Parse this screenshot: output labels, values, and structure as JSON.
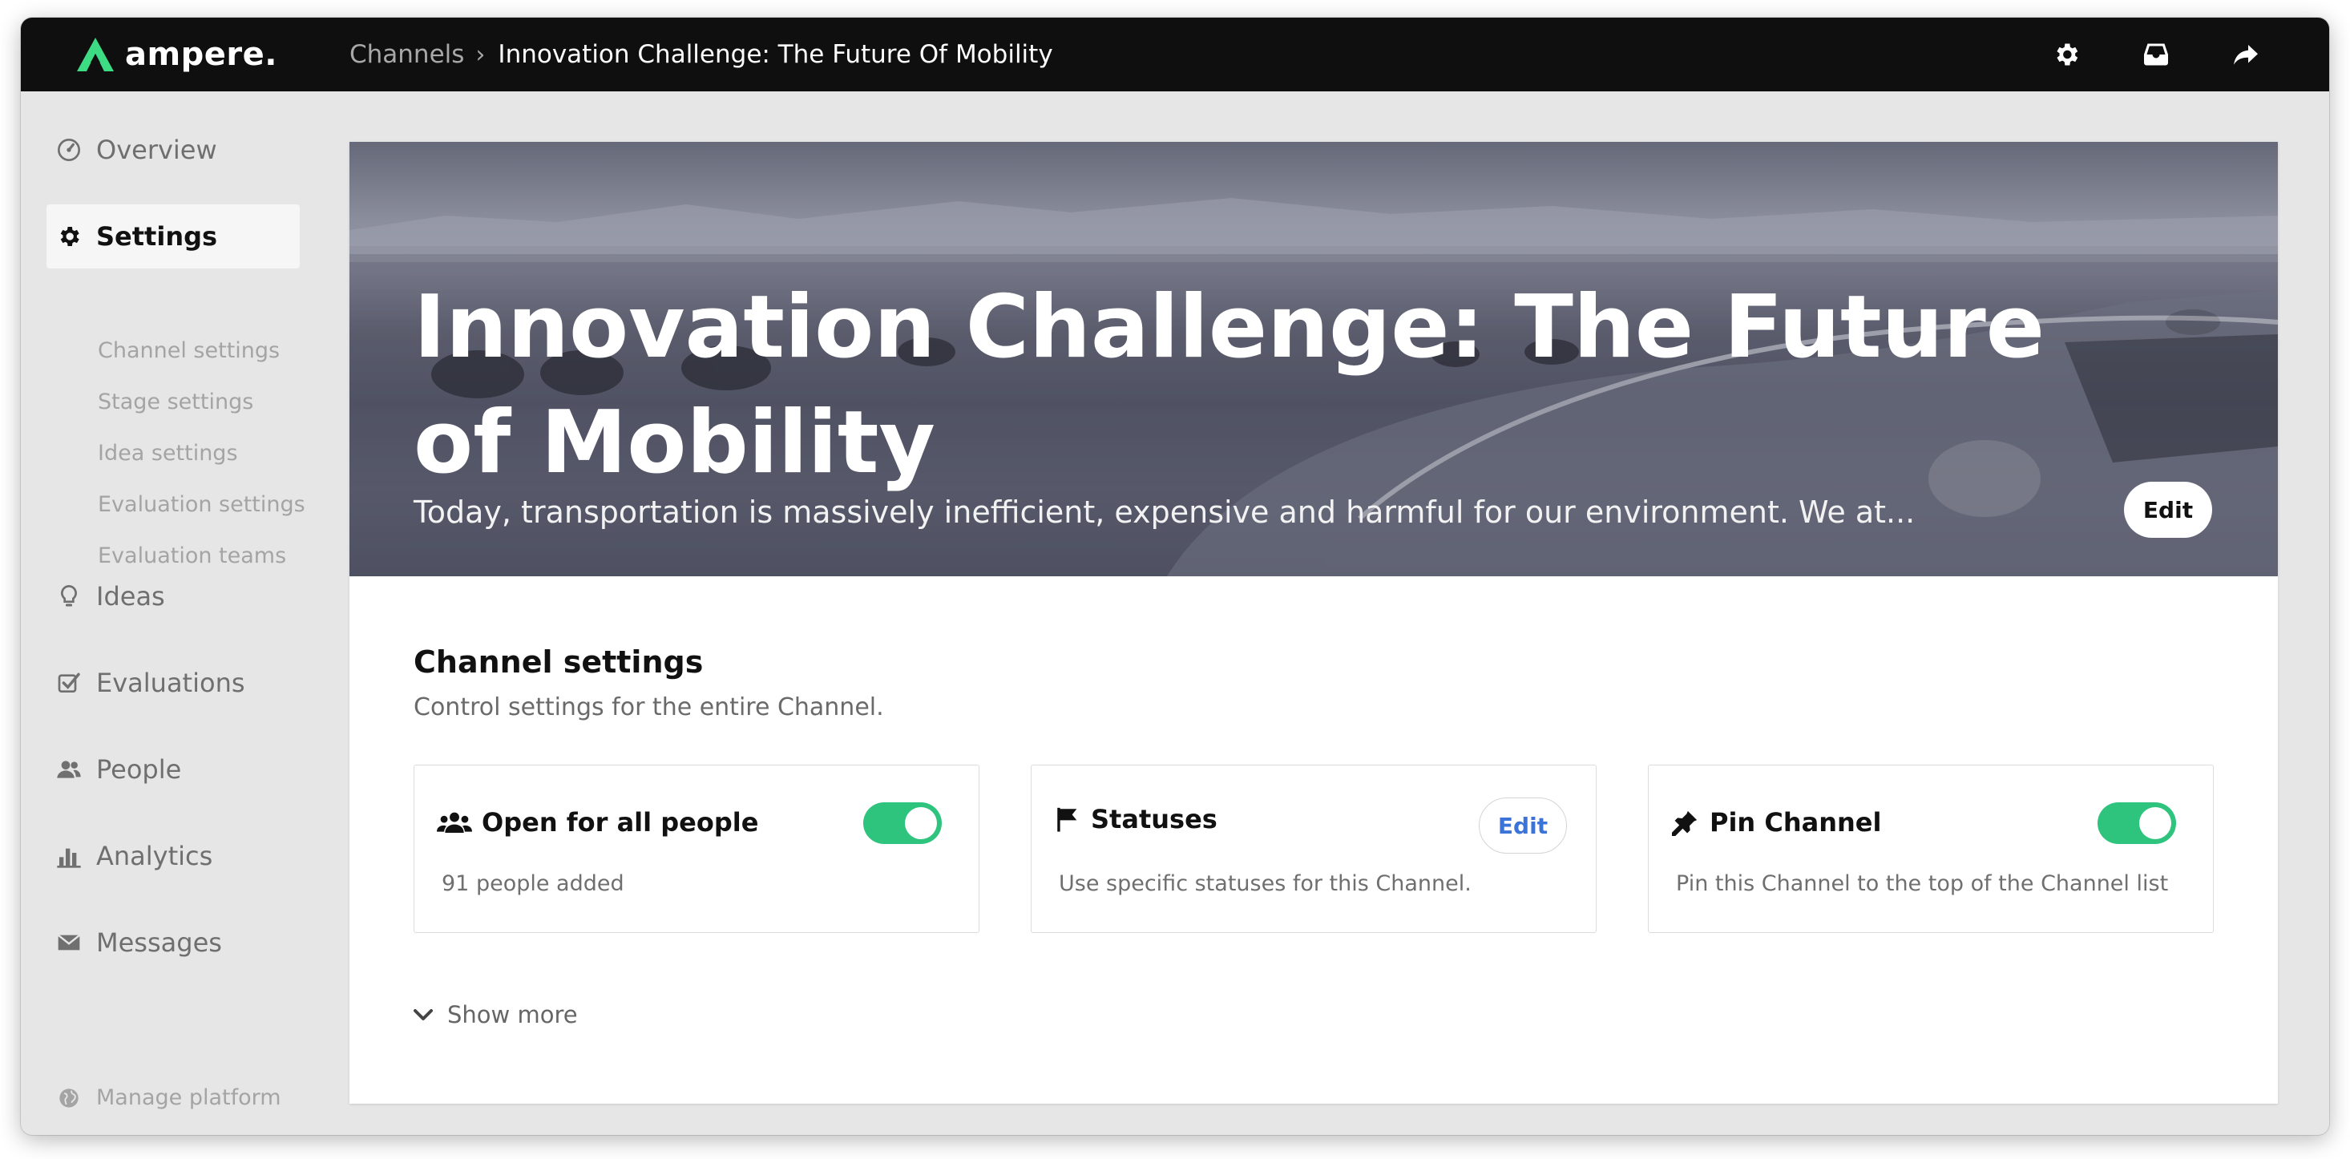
{
  "header": {
    "logo_text": "ampere.",
    "breadcrumb": {
      "parent": "Channels",
      "separator": "›",
      "current": "Innovation Challenge: The Future Of Mobility"
    },
    "icons": [
      "gear-icon",
      "inbox-icon",
      "share-icon"
    ]
  },
  "sidebar": {
    "overview": "Overview",
    "settings": "Settings",
    "settings_sub": [
      "Channel settings",
      "Stage settings",
      "Idea settings",
      "Evaluation settings",
      "Evaluation teams"
    ],
    "ideas": "Ideas",
    "evaluations": "Evaluations",
    "people": "People",
    "analytics": "Analytics",
    "messages": "Messages",
    "manage_platform": "Manage platform"
  },
  "hero": {
    "title": "Innovation Challenge: The Future of Mobility",
    "description": "Today, transportation is massively inefficient, expensive and harmful for our environment. We at...",
    "edit_label": "Edit"
  },
  "channel_settings": {
    "title": "Channel settings",
    "subtitle": "Control settings for the entire Channel.",
    "cards": [
      {
        "title": "Open for all people",
        "description": "91 people added",
        "toggle_on": true
      },
      {
        "title": "Statuses",
        "description": "Use specific statuses for this Channel.",
        "edit_label": "Edit"
      },
      {
        "title": "Pin Channel",
        "description": "Pin this Channel to the top of the Channel list",
        "toggle_on": true
      }
    ],
    "show_more": "Show more"
  },
  "colors": {
    "accent_green": "#2ec47d",
    "link_blue": "#3b73d9",
    "topbar": "#0f0f0f",
    "logo_green": "#3ddc84"
  }
}
